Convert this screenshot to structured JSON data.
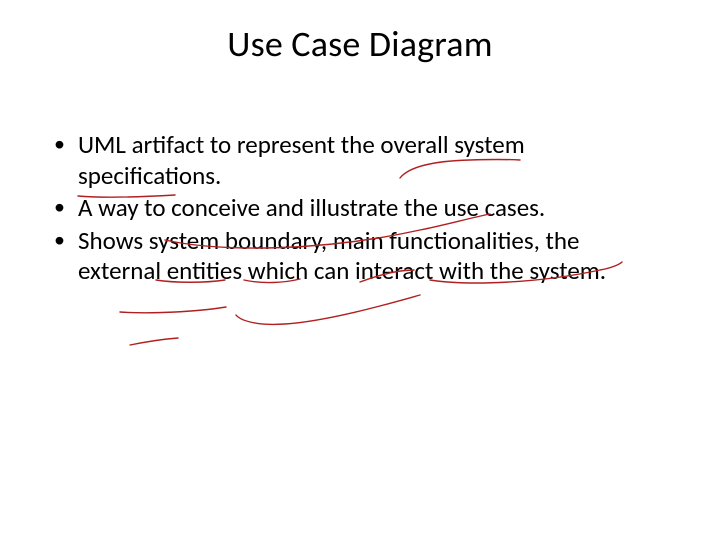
{
  "title": "Use Case Diagram",
  "bullets": [
    "UML artifact to represent the overall system specifications.",
    "A way to conceive and illustrate the use cases.",
    "Shows system boundary, main functionalities, the external entities which can interact with the system."
  ]
}
